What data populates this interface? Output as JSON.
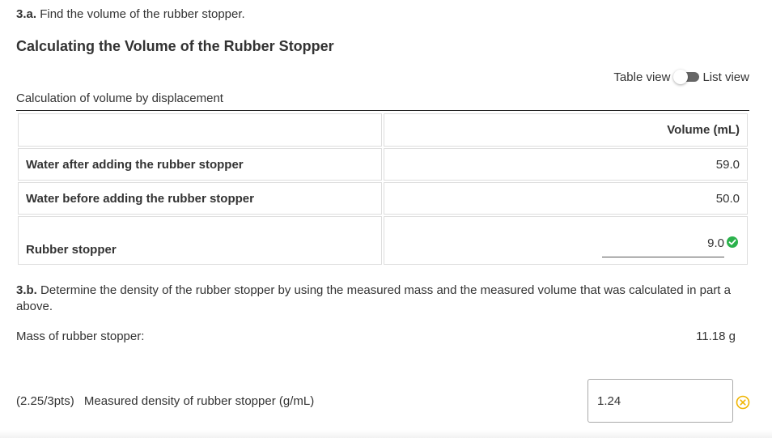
{
  "part_a": {
    "number": "3.a.",
    "text": "Find the volume of the rubber stopper."
  },
  "section_title": "Calculating the Volume of the Rubber Stopper",
  "view_toggle": {
    "left_label": "Table view",
    "right_label": "List view"
  },
  "table": {
    "caption": "Calculation of volume by displacement",
    "header": "Volume (mL)",
    "rows": [
      {
        "label": "Water after adding the rubber stopper",
        "value": "59.0"
      },
      {
        "label": "Water before adding the rubber stopper",
        "value": "50.0"
      },
      {
        "label": "Rubber stopper",
        "value": "9.0"
      }
    ]
  },
  "part_b": {
    "number": "3.b.",
    "text": "Determine the density of the rubber stopper by using the measured mass and the measured volume that was calculated in part a above."
  },
  "mass": {
    "label": "Mass of rubber stopper:",
    "value": "11.18 g"
  },
  "density": {
    "score": "(2.25/3pts)",
    "label": "Measured density of rubber stopper (g/mL)",
    "value": "1.24"
  },
  "colors": {
    "correct": "#2bb24c",
    "incorrect": "#f0b400"
  }
}
